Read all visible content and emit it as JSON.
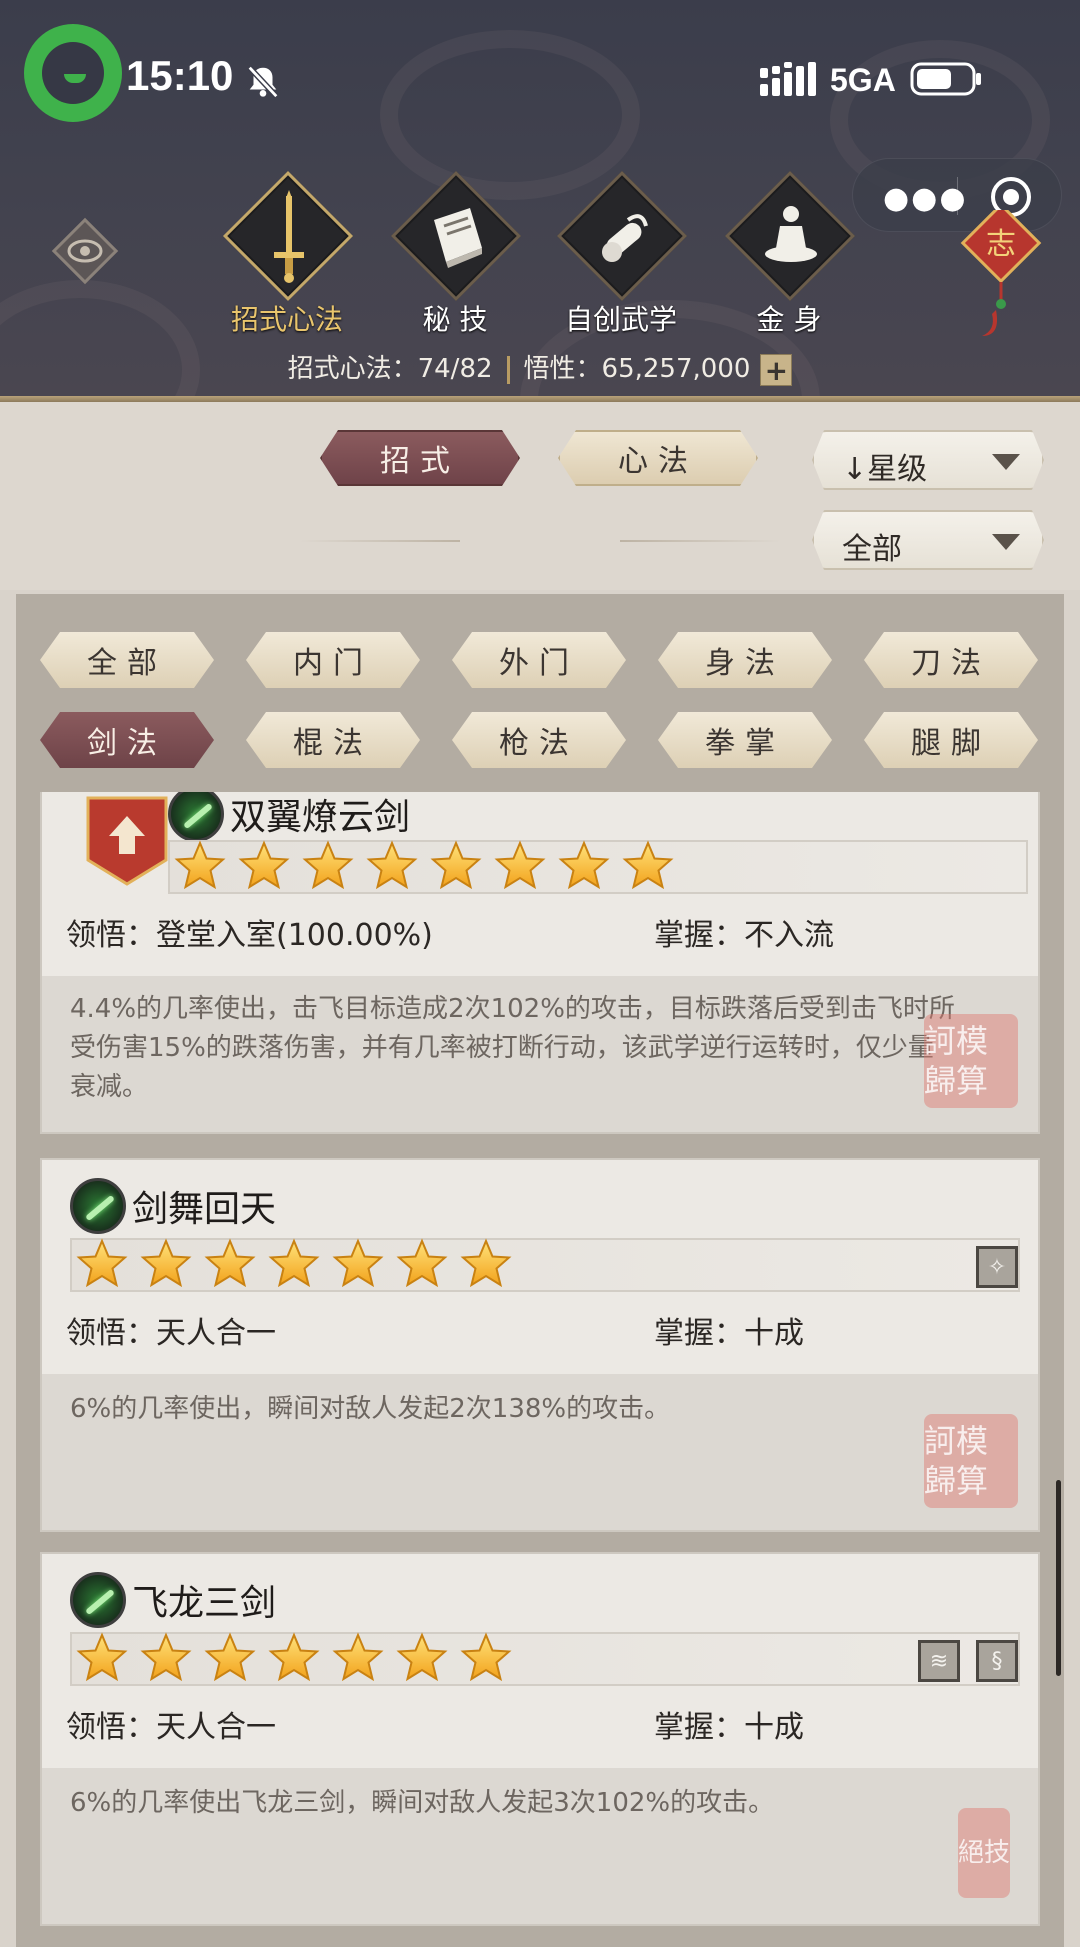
{
  "status_bar": {
    "time": "15:10",
    "network": "5GA"
  },
  "nav": {
    "items": [
      {
        "label": "招式心法",
        "active": true,
        "icon": "sword-icon"
      },
      {
        "label": "秘 技",
        "active": false,
        "icon": "book-icon"
      },
      {
        "label": "自创武学",
        "active": false,
        "icon": "scroll-icon"
      },
      {
        "label": "金 身",
        "active": false,
        "icon": "meditation-icon"
      }
    ],
    "charm_text": "志"
  },
  "resource": {
    "moves_label": "招式心法：74/82",
    "insight_label": "悟性：65,257,000",
    "plus": "+"
  },
  "tabs": {
    "moves": "招式",
    "mind": "心法"
  },
  "sort": {
    "value": "星级",
    "arrow": "↓"
  },
  "filter_scope": {
    "value": "全部"
  },
  "categories": [
    {
      "label": "全部",
      "active": false
    },
    {
      "label": "内门",
      "active": false
    },
    {
      "label": "外门",
      "active": false
    },
    {
      "label": "身法",
      "active": false
    },
    {
      "label": "刀法",
      "active": false
    },
    {
      "label": "剑法",
      "active": true
    },
    {
      "label": "棍法",
      "active": false
    },
    {
      "label": "枪法",
      "active": false
    },
    {
      "label": "拳掌",
      "active": false
    },
    {
      "label": "腿脚",
      "active": false
    }
  ],
  "skills": [
    {
      "name": "双翼燎云剑",
      "stars": 8,
      "comprehension": "领悟：登堂入室(100.00%)",
      "mastery": "掌握：不入流",
      "description": "4.4%的几率使出，击飞目标造成2次102%的攻击，目标跌落后受到击飞时所受伤害15%的跌落伤害，并有几率被打断行动，该武学逆行运转时，仅少量衰减。",
      "seal": "訶模歸算"
    },
    {
      "name": "剑舞回天",
      "stars": 7,
      "comprehension": "领悟：天人合一",
      "mastery": "掌握：十成",
      "description": "6%的几率使出，瞬间对敌人发起2次138%的攻击。",
      "seal": "訶模歸算"
    },
    {
      "name": "飞龙三剑",
      "stars": 7,
      "comprehension": "领悟：天人合一",
      "mastery": "掌握：十成",
      "description": "6%的几率使出飞龙三剑，瞬间对敌人发起3次102%的攻击。",
      "seal": "絕技"
    }
  ]
}
